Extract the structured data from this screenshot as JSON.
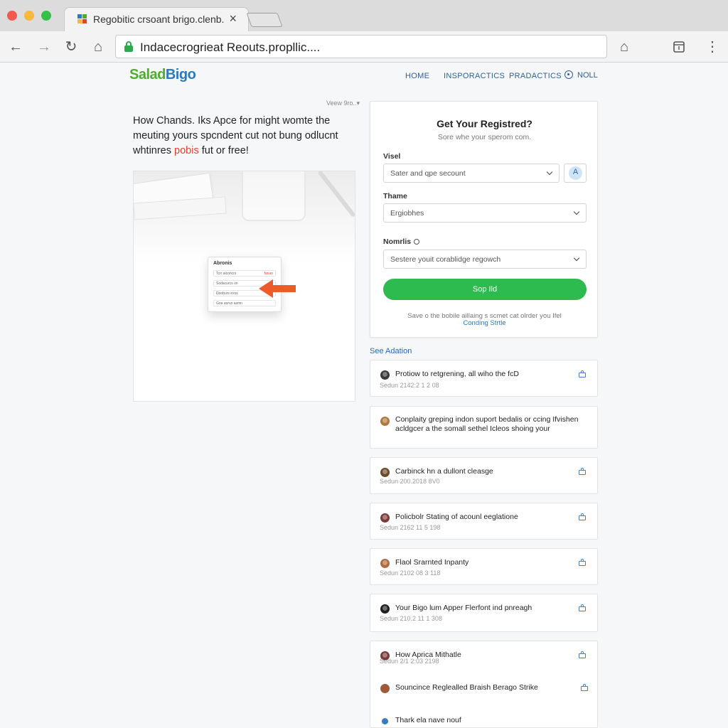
{
  "browser": {
    "tab_title": "Regobitic crsoant brigo.clenb.",
    "tab_close": "×",
    "url": "Indacecrogrieat Reouts.propllic....",
    "back_glyph": "←",
    "forward_glyph": "→",
    "reload_glyph": "↻",
    "home_glyph": "⌂",
    "menu_glyph": "⋮",
    "icons": [
      "back-arrow-icon",
      "forward-arrow-icon",
      "reload-icon",
      "home-icon",
      "lock-icon",
      "home-icon",
      "tab-icon",
      "more-vertical-icon"
    ]
  },
  "site": {
    "logo_part1": "Salad",
    "logo_part2": "Bigo",
    "nav": [
      "HOME",
      "INSPORACTICS",
      "PRADACTICS",
      "NOLL"
    ]
  },
  "article": {
    "view_source": "Veew 9ro..▾",
    "headline_lines": [
      "How Chands. Iks Apce for might womte the",
      "meuting yours spcndent cut not bung odlucnt",
      "whtinres"
    ],
    "headline_highlight": "pobis",
    "headline_tail": "fut or free!",
    "image": {
      "card_title": "Abronis",
      "rows": [
        {
          "label": "Tcrr alconcrs",
          "tag": "fanan"
        },
        {
          "label": "Sodacurcs on",
          "tag": ""
        },
        {
          "label": "Dooburs exss",
          "tag": ""
        },
        {
          "label": "Goa aorvo asmn",
          "tag": ""
        }
      ]
    }
  },
  "registration": {
    "title": "Get Your Registred?",
    "subtitle": "Sore whe your sperom com.",
    "fields": [
      {
        "label": "Visel",
        "value": "Sater and qpe secount"
      },
      {
        "label": "Thame",
        "value": "Ergiobhes"
      },
      {
        "label": "Nomrlis",
        "value": "Sestere youit corablidge regowch"
      }
    ],
    "icon_button_glyph": "A",
    "submit_label": "Sop Ild",
    "note": "Save o the bobile aillaing s scmet cat olrder you Ifel",
    "link": "Conding Strtle"
  },
  "activity": {
    "heading": "See Adation",
    "items": [
      {
        "title": "Protiow to retgrening, all wiho the fcD",
        "meta": "Sedun 2142:2 1 2 08",
        "avatar": "#3a3a3a"
      },
      {
        "title": "Conplaity greping indon suport bedalis or ccing Ifvishen acldgcer a the somall sethel Icleos shoing your",
        "meta": "",
        "avatar": "#b07840"
      },
      {
        "title": "Carbinck hn a dullont cleasge",
        "meta": "Sedun 200.2018 8V0",
        "avatar": "#6b4a2a"
      },
      {
        "title": "Policbolr Stating of acounl eeglatione",
        "meta": "Sedun 2162 11 5 198",
        "avatar": "#7a3a3a"
      },
      {
        "title": "Flaol Srarnted Inpanty",
        "meta": "Sedun 2102 08 3 118",
        "avatar": "#b06a40"
      },
      {
        "title": "Your Bigo lum Apper Flerfont ind pnreagh",
        "meta": "Sedun 210.2 11 1 308",
        "avatar": "#1f1f1f"
      },
      {
        "title": "How Aprica Mithatle",
        "meta": "Sedun 2/1 2:03 2198",
        "avatar": "#7a3a3a"
      }
    ],
    "extra_rows": [
      {
        "title": "Souncince Reglealled Braish Berago Strike",
        "avatar": "#a05a3a"
      },
      {
        "title": "Thark ela nave nouf",
        "avatar": "#3a7ac0"
      }
    ]
  },
  "colors": {
    "accent_green": "#2dbb50",
    "link_blue": "#2a7abf",
    "highlight_red": "#e0452a"
  }
}
